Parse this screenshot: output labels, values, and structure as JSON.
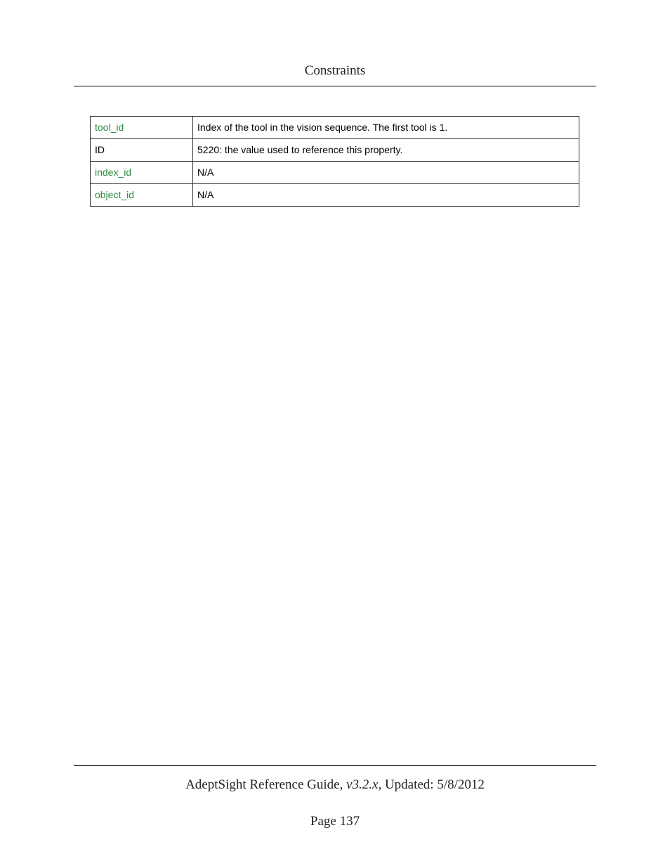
{
  "header": {
    "title": "Constraints"
  },
  "table": {
    "rows": [
      {
        "key": "tool_id",
        "key_color": "green",
        "value": "Index of the tool in the vision sequence. The first tool is 1."
      },
      {
        "key": "ID",
        "key_color": "black",
        "value": "5220: the value used to reference this property."
      },
      {
        "key": "index_id",
        "key_color": "green",
        "value": "N/A"
      },
      {
        "key": "object_id",
        "key_color": "green",
        "value": "N/A"
      }
    ]
  },
  "footer": {
    "guide_name": "AdeptSight Reference Guide",
    "version": ", v3.2.x",
    "updated_label": ", Updated: ",
    "updated_date": "5/8/2012",
    "page_label": "Page 137"
  }
}
